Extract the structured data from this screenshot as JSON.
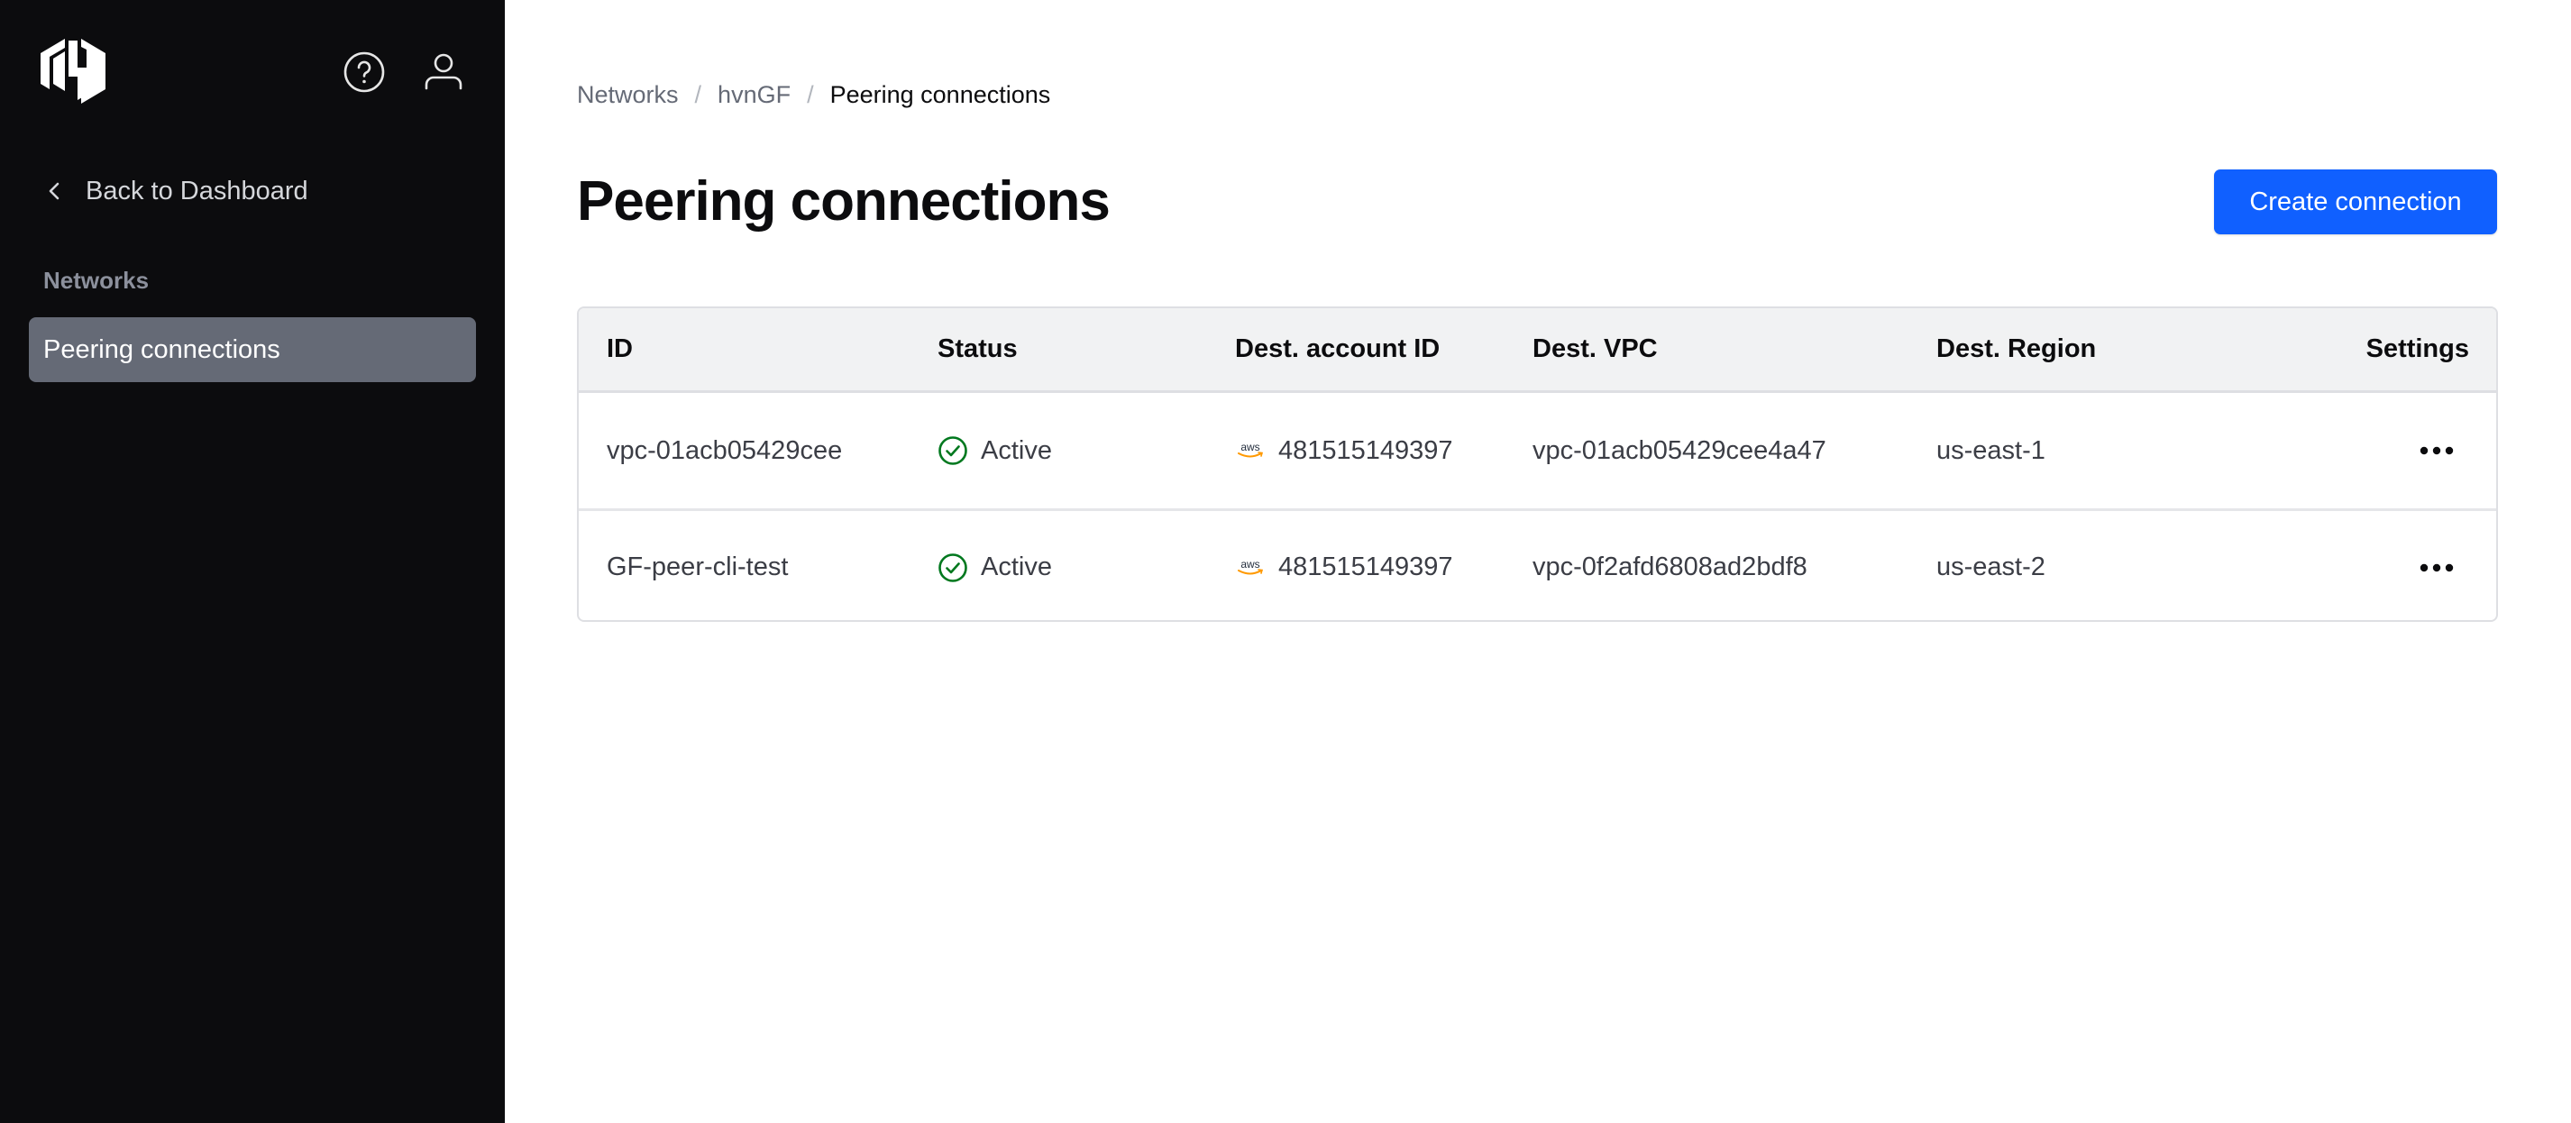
{
  "sidebar": {
    "back_label": "Back to Dashboard",
    "section_heading": "Networks",
    "active_item": "Peering connections"
  },
  "breadcrumb": {
    "items": [
      "Networks",
      "hvnGF"
    ],
    "current": "Peering connections",
    "separator": "/"
  },
  "page": {
    "title": "Peering connections",
    "create_button": "Create connection"
  },
  "colors": {
    "primary": "#1060ff",
    "sidebar_bg": "#0c0c0e",
    "active_nav": "#656a76",
    "success": "#00781e",
    "aws_orange": "#ff9900"
  },
  "table": {
    "columns": [
      "ID",
      "Status",
      "Dest. account ID",
      "Dest. VPC",
      "Dest. Region",
      "Settings"
    ],
    "rows": [
      {
        "id": "vpc-01acb05429cee",
        "status": "Active",
        "provider": "aws",
        "account_id": "481515149397",
        "vpc": "vpc-01acb05429cee4a47",
        "region": "us-east-1"
      },
      {
        "id": "GF-peer-cli-test",
        "status": "Active",
        "provider": "aws",
        "account_id": "481515149397",
        "vpc": "vpc-0f2afd6808ad2bdf8",
        "region": "us-east-2"
      }
    ]
  }
}
